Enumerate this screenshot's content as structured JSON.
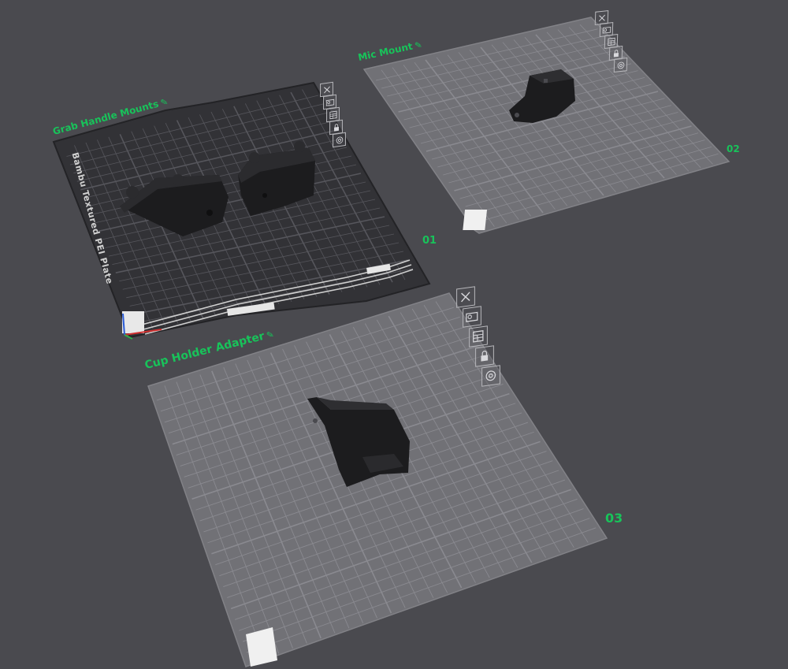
{
  "plates": [
    {
      "name": "Grab Handle Mounts",
      "number": "01",
      "bed_texture_label": "Bambu Textured PEI Plate",
      "colors": {
        "bed": "#323236",
        "grid": "#56565c"
      }
    },
    {
      "name": "Mic Mount",
      "number": "02",
      "colors": {
        "bed": "#717176",
        "grid": "#8a8a90"
      }
    },
    {
      "name": "Cup Holder Adapter",
      "number": "03",
      "colors": {
        "bed": "#717176",
        "grid": "#8a8a90"
      }
    }
  ],
  "plate_tools": [
    {
      "id": "delete",
      "icon": "close-icon"
    },
    {
      "id": "auto-orient",
      "icon": "orient-icon"
    },
    {
      "id": "arrange",
      "icon": "arrange-icon"
    },
    {
      "id": "lock",
      "icon": "lock-icon"
    },
    {
      "id": "settings",
      "icon": "settings-icon"
    }
  ],
  "edit_icon": "pencil-icon",
  "colors": {
    "background": "#4a4a4f",
    "accent_label": "#18c35a",
    "model": "#1c1c1e"
  }
}
